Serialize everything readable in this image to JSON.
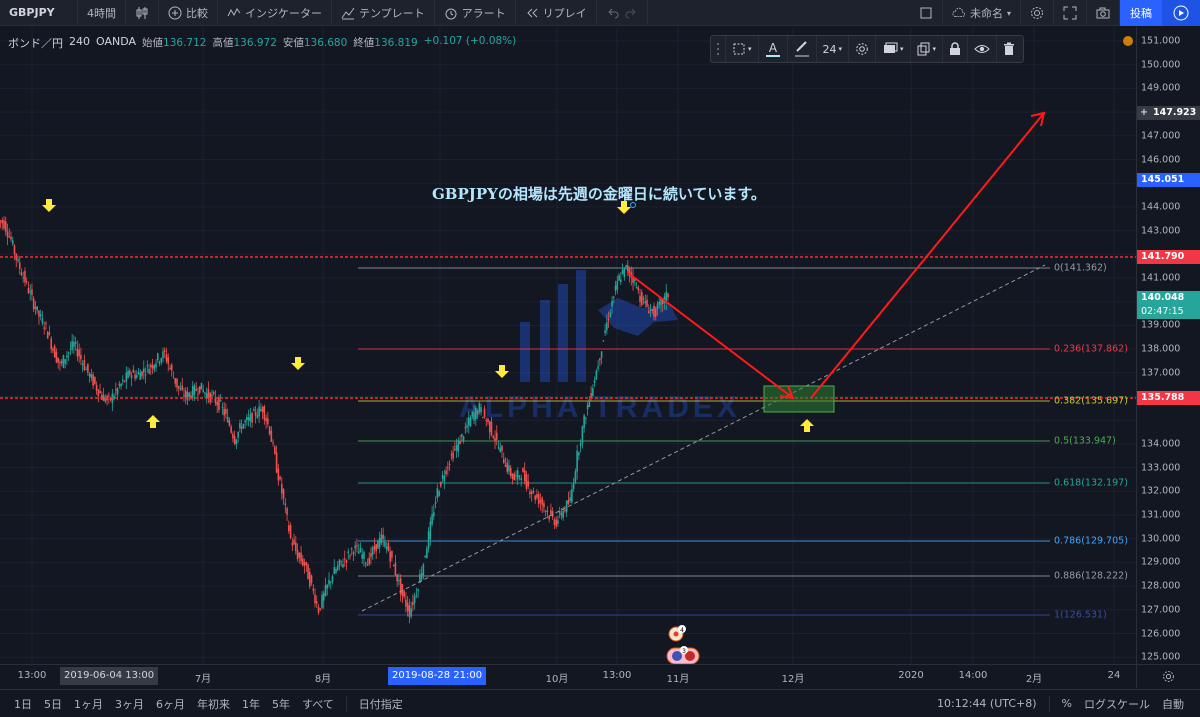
{
  "toolbar": {
    "symbol": "GBPJPY",
    "interval": "4時間",
    "compare": "比較",
    "indicators": "インジケーター",
    "templates": "テンプレート",
    "alert": "アラート",
    "replay": "リプレイ",
    "layout_name": "未命名",
    "publish": "投稿"
  },
  "legend": {
    "name": "ボンド／円",
    "interval": "240",
    "source": "OANDA",
    "open_label": "始値",
    "open": "136.712",
    "high_label": "高値",
    "high": "136.972",
    "low_label": "安値",
    "low": "136.680",
    "close_label": "終値",
    "close": "136.819",
    "change": "+0.107 (+0.08%)"
  },
  "drawing_toolbar": {
    "font_size": "24"
  },
  "annotation": "GBPJPYの相場は先週の金曜日に続いています。",
  "watermark": "ALPHA TRADEX",
  "price_axis": {
    "ticks": [
      "151.000",
      "150.000",
      "149.000",
      "147.000",
      "146.000",
      "144.000",
      "143.000",
      "141.000",
      "139.000",
      "138.000",
      "137.000",
      "136.000",
      "134.000",
      "133.000",
      "132.000",
      "131.000",
      "130.000",
      "129.000",
      "128.000",
      "127.000",
      "126.000",
      "125.000"
    ],
    "tags": {
      "crosshair": "147.923",
      "blue_level": "145.051",
      "red_top": "141.790",
      "last_price": "140.048",
      "countdown": "02:47:15",
      "red_bottom": "135.788"
    }
  },
  "fib_levels": [
    {
      "label": "0(141.362)",
      "color": "#9598a1"
    },
    {
      "label": "0.236(137.862)",
      "color": "#f23645"
    },
    {
      "label": "0.382(135.697)",
      "color": "#c0ca33"
    },
    {
      "label": "0.5(133.947)",
      "color": "#4caf50"
    },
    {
      "label": "0.618(132.197)",
      "color": "#26a69a"
    },
    {
      "label": "0.786(129.705)",
      "color": "#42a5f5"
    },
    {
      "label": "0.886(128.222)",
      "color": "#9598a1"
    },
    {
      "label": "1(126.531)",
      "color": "#3949ab"
    }
  ],
  "time_axis": {
    "labels": [
      "13:00",
      "7月",
      "8月",
      "10月",
      "13:00",
      "11月",
      "12月",
      "2020",
      "14:00",
      "2月",
      "24"
    ],
    "tags": [
      "2019-06-04   13:00",
      "2019-08-28   21:00"
    ]
  },
  "bottom_bar": {
    "ranges": [
      "1日",
      "5日",
      "1ヶ月",
      "3ヶ月",
      "6ヶ月",
      "年初来",
      "1年",
      "5年",
      "すべて"
    ],
    "goto_date": "日付指定",
    "clock": "10:12:44 (UTC+8)",
    "percent": "%",
    "log_scale": "ログスケール",
    "auto": "自動"
  },
  "badges": {
    "top": "4",
    "bottom": "3"
  },
  "colors": {
    "background": "#131722",
    "accent": "#2962ff",
    "up": "#26a69a",
    "down": "#ef5350",
    "arrow_yellow": "#ffeb3b",
    "red_line": "#ff2a2a"
  },
  "chart_data": {
    "type": "candlestick",
    "title": "",
    "ylim": [
      124.6,
      151.8
    ],
    "series": [
      {
        "values": [
          143.3,
          142.6,
          141.6,
          140.9,
          140.1,
          139.4,
          138.9,
          138.0,
          137.3,
          137.8,
          138.2,
          137.6,
          137.0,
          136.5,
          136.0,
          135.8,
          136.2,
          136.6,
          137.0,
          136.9,
          137.1,
          137.3,
          137.6,
          137.8,
          137.0,
          136.3,
          136.0,
          136.2,
          136.4,
          136.1,
          135.9,
          135.6,
          135.0,
          134.2,
          134.8,
          135.0,
          135.3,
          135.5,
          134.6,
          133.0,
          131.6,
          130.0,
          129.3,
          128.9,
          128.0,
          127.0,
          127.8,
          128.5,
          128.9,
          129.2,
          129.6,
          129.4,
          129.0,
          129.6,
          130.0,
          129.5,
          128.6,
          127.6,
          126.9,
          127.8,
          129.0,
          130.5,
          132.0,
          132.8,
          133.5,
          134.0,
          134.6,
          135.2,
          135.5,
          135.0,
          134.4,
          133.7,
          133.0,
          132.5,
          132.8,
          132.2,
          131.8,
          131.5,
          131.0,
          130.7,
          131.2,
          131.6,
          133.5,
          135.0,
          136.2,
          137.4,
          138.8,
          140.0,
          141.0,
          141.4,
          141.0,
          140.2,
          139.8,
          139.5,
          139.9,
          140.3
        ]
      }
    ]
  }
}
